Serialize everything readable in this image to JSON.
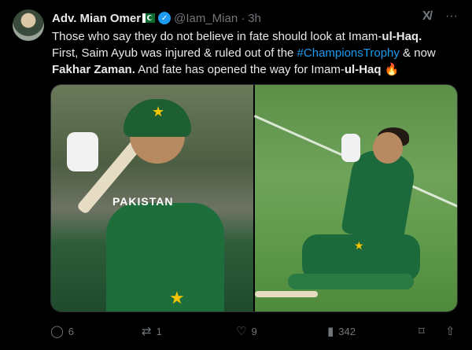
{
  "author": {
    "name": "Adv. Mian Omer",
    "handle": "@Iam_Mian",
    "separator": "·",
    "time": "3h"
  },
  "icons": {
    "flag": "pakistan-flag-icon",
    "verified": "verified-badge-icon",
    "grok": "grok-icon",
    "more": "more-options-icon"
  },
  "tweet": {
    "line1_a": "Those who say they do not believe in fate should look at Imam-",
    "line1_b": "ul-Haq",
    "line1_c": ".",
    "line2_a": "First, Saim Ayub was injured & ruled out of the ",
    "hashtag": "#ChampionsTrophy",
    "line2_b": " & now",
    "line3_a": "Fakhar Zaman.",
    "line3_b": " And fate has opened the way for Imam-",
    "line3_c": "ul-Haq",
    "emoji": "🔥"
  },
  "media": {
    "left_jersey_text": "PAKISTAN"
  },
  "actions": {
    "replies": "6",
    "reposts": "1",
    "likes": "9",
    "views": "342"
  },
  "colors": {
    "background": "#000000",
    "text": "#e7e9ea",
    "muted": "#71767b",
    "accent": "#1d9bf0"
  }
}
